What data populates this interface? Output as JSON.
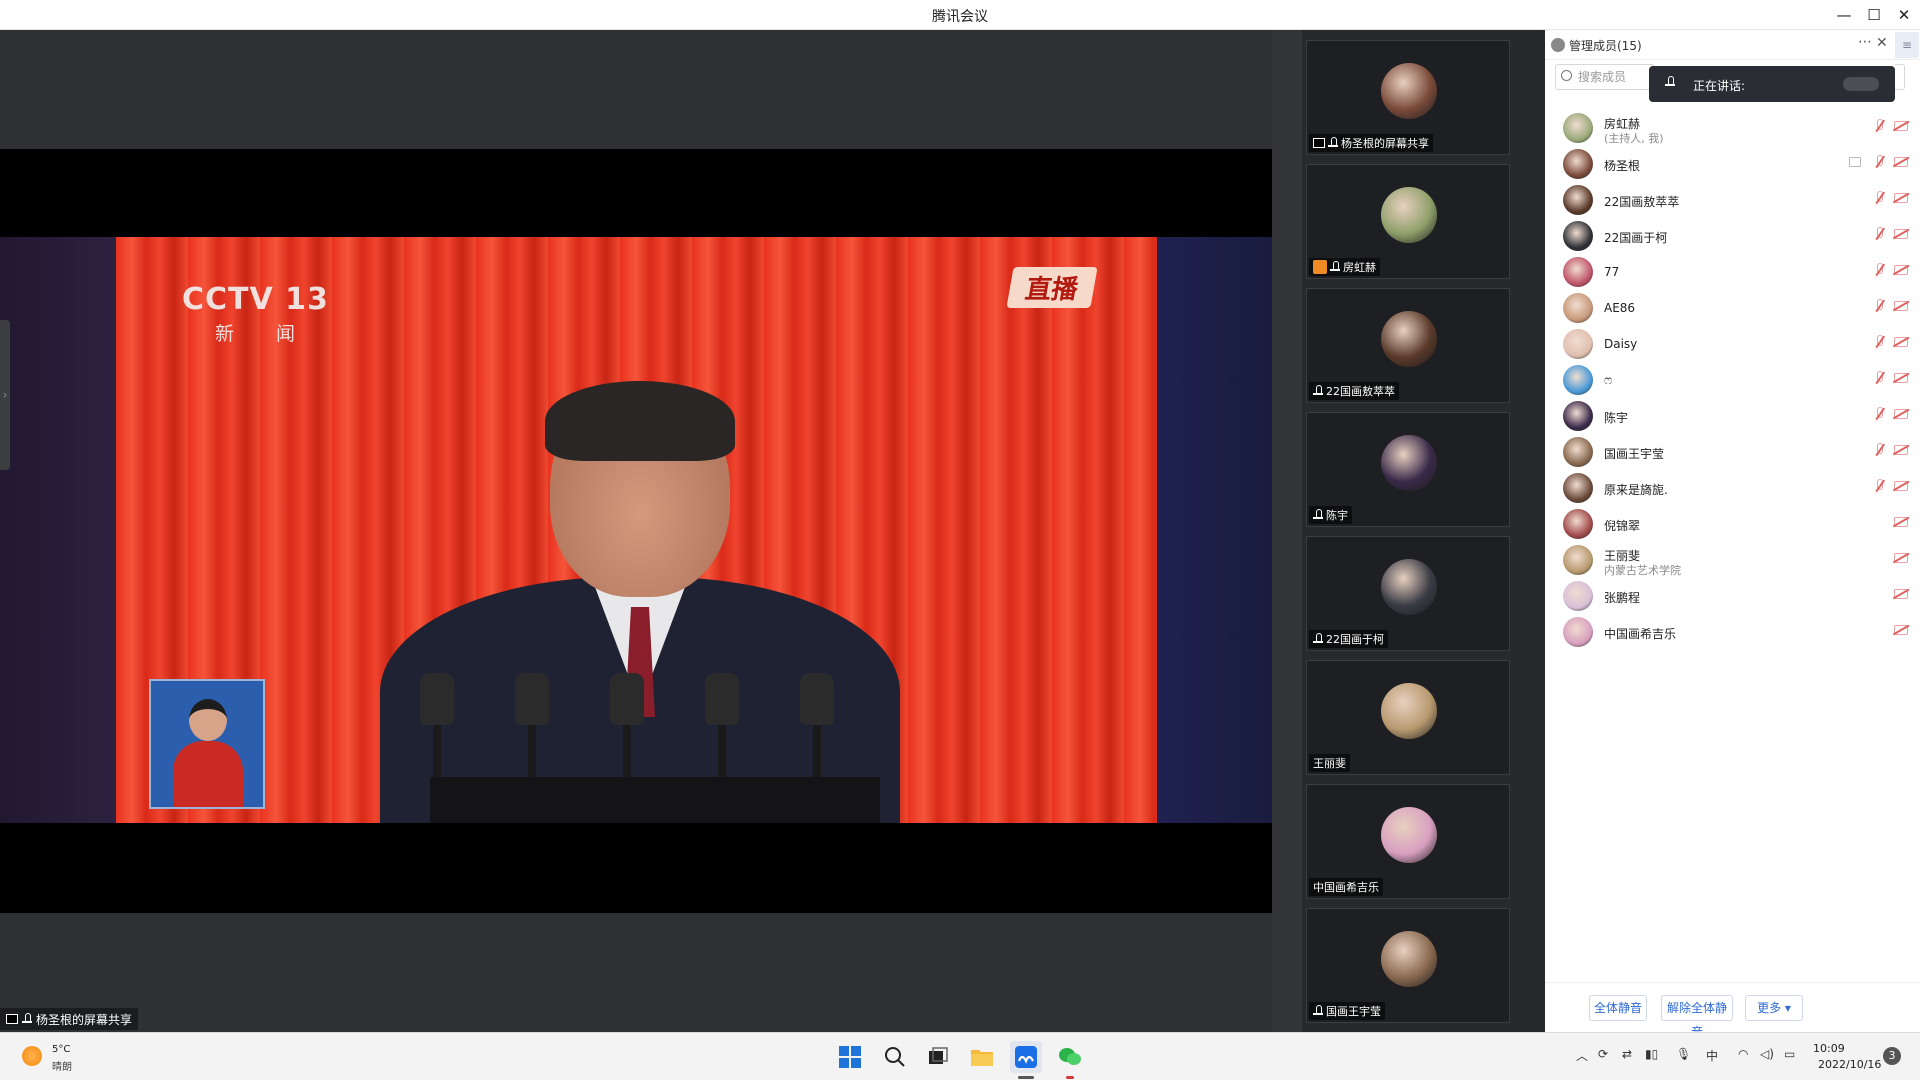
{
  "window": {
    "title": "腾讯会议"
  },
  "stage": {
    "share_label": "杨圣根的屏幕共享",
    "broadcast": {
      "logo_text": "CCTV 13",
      "logo_sub": "新 闻",
      "live_badge": "直播"
    }
  },
  "thumbnails": [
    {
      "label": "杨圣根的屏幕共享",
      "screen_icon": true,
      "host_icon": false,
      "avatar_color": "#7a4a3a"
    },
    {
      "label": "房虹赫",
      "screen_icon": false,
      "host_icon": true,
      "avatar_color": "#8fa06a"
    },
    {
      "label": "22国画敖萃萃",
      "screen_icon": false,
      "host_icon": false,
      "avatar_color": "#5a3a2a"
    },
    {
      "label": "陈宇",
      "screen_icon": false,
      "host_icon": false,
      "avatar_color": "#3a2a4a"
    },
    {
      "label": "22国画于柯",
      "screen_icon": false,
      "host_icon": false,
      "avatar_color": "#3a3c45"
    },
    {
      "label": "王丽斐",
      "screen_icon": false,
      "host_icon": false,
      "avatar_color": "#b89a70",
      "no_mic": true
    },
    {
      "label": "中国画希吉乐",
      "screen_icon": false,
      "host_icon": false,
      "avatar_color": "#d8a0c0",
      "no_mic": true
    },
    {
      "label": "国画王宇莹",
      "screen_icon": false,
      "host_icon": false,
      "avatar_color": "#8a6a50"
    }
  ],
  "members": {
    "title": "管理成员(15)",
    "search_placeholder": "搜索成员",
    "speaking_label": "正在讲话:",
    "list": [
      {
        "name": "房虹赫",
        "sub": "(主持人, 我)",
        "avatar_color": "#9aaa7a",
        "mic": true,
        "screen": false
      },
      {
        "name": "杨圣根",
        "sub": "",
        "avatar_color": "#7a4a3a",
        "mic": true,
        "screen": true
      },
      {
        "name": "22国画敖萃萃",
        "sub": "",
        "avatar_color": "#5a3a2a",
        "mic": true,
        "screen": false
      },
      {
        "name": "22国画于柯",
        "sub": "",
        "avatar_color": "#2f3036",
        "mic": true,
        "screen": false
      },
      {
        "name": "77",
        "sub": "",
        "avatar_color": "#c0556a",
        "mic": true,
        "screen": false
      },
      {
        "name": "AE86",
        "sub": "",
        "avatar_color": "#c89a7a",
        "mic": true,
        "screen": false
      },
      {
        "name": "Daisy",
        "sub": "",
        "avatar_color": "#e0c0b0",
        "mic": true,
        "screen": false
      },
      {
        "name": "ෆ",
        "sub": "",
        "avatar_color": "#4a9ad8",
        "mic": true,
        "screen": false
      },
      {
        "name": "陈宇",
        "sub": "",
        "avatar_color": "#3a2a4a",
        "mic": true,
        "screen": false
      },
      {
        "name": "国画王宇莹",
        "sub": "",
        "avatar_color": "#8a6a50",
        "mic": true,
        "screen": false
      },
      {
        "name": "原来是旖旎.",
        "sub": "",
        "avatar_color": "#6a4a3a",
        "mic": true,
        "screen": false
      },
      {
        "name": "倪锦翠",
        "sub": "",
        "avatar_color": "#a04a4a",
        "mic": false,
        "screen": false
      },
      {
        "name": "王丽斐",
        "sub": "内蒙古艺术学院",
        "avatar_color": "#b89a70",
        "mic": false,
        "screen": false
      },
      {
        "name": "张鹏程",
        "sub": "",
        "avatar_color": "#d8c0d8",
        "mic": false,
        "screen": false
      },
      {
        "name": "中国画希吉乐",
        "sub": "",
        "avatar_color": "#d8a0c0",
        "mic": false,
        "screen": false
      }
    ],
    "footer": {
      "mute_all": "全体静音",
      "unmute_all": "解除全体静音",
      "more": "更多 ▾"
    }
  },
  "taskbar": {
    "weather_temp": "5°C",
    "weather_desc": "晴朗",
    "ime": "中",
    "time": "10:09",
    "date": "2022/10/16",
    "notifications": "3"
  }
}
